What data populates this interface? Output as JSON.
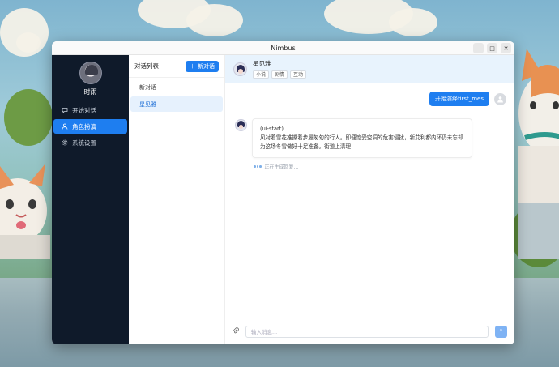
{
  "window": {
    "title": "Nimbus",
    "minimize": "–",
    "maximize": "□",
    "close": "✕"
  },
  "user": {
    "name": "时雨"
  },
  "nav": {
    "items": [
      {
        "label": "开始对话",
        "icon": "chat-icon"
      },
      {
        "label": "角色扮演",
        "icon": "person-icon",
        "active": true
      },
      {
        "label": "系统设置",
        "icon": "gear-icon"
      }
    ]
  },
  "conversations": {
    "title": "对话列表",
    "new_button": "新对话",
    "items": [
      {
        "label": "新对话"
      },
      {
        "label": "星见雅",
        "active": true
      }
    ]
  },
  "chat": {
    "character_name": "星见雅",
    "tags": [
      "小说",
      "剧情",
      "互动"
    ],
    "user_message": "开始演绎first_mes",
    "bot_message_line1": "(ui-start)",
    "bot_message_body": "风衬着雪花推搡着步履匆匆的行人。即便饱受空洞的危害侵扰，新艾利都内环仍未忘却为这场冬雪做好十足准备。街道上清理",
    "typing_status": "正在生成回复...",
    "input_placeholder": "输入消息...",
    "send_icon": "↑"
  },
  "colors": {
    "accent": "#1e7ef0",
    "nav_bg": "#0f1a2a",
    "chat_header_bg": "#e8f3fd"
  }
}
